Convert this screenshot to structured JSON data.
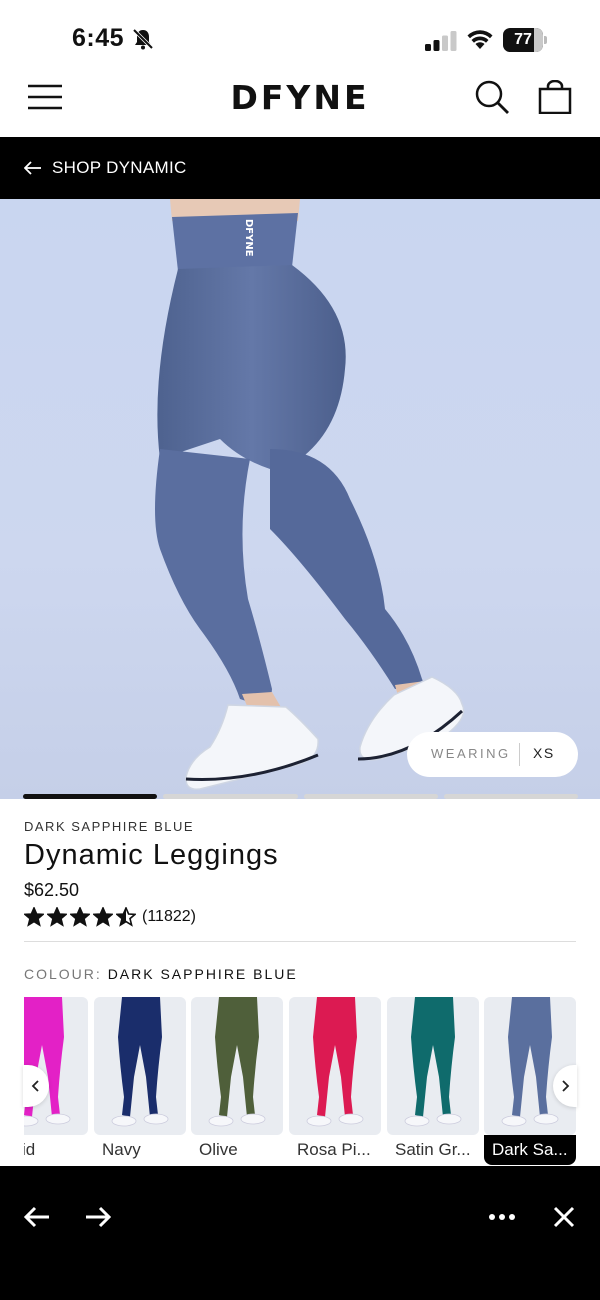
{
  "status_bar": {
    "time": "6:45",
    "battery_level": "77",
    "battery_fraction": 0.77,
    "icons": [
      "bell-slash-icon",
      "cellular-signal-icon",
      "wifi-icon",
      "battery-icon"
    ]
  },
  "header": {
    "logo_text": "DFYNE",
    "icons": [
      "hamburger-menu-icon",
      "search-icon",
      "shopping-bag-icon"
    ]
  },
  "shop_bar": {
    "label": "SHOP DYNAMIC",
    "icon": "arrow-left-icon"
  },
  "hero": {
    "waistband_text": "DFYNE",
    "wearing_label": "WEARING",
    "wearing_size": "XS",
    "slide_count": 4,
    "active_slide": 1
  },
  "product": {
    "colour_name": "DARK SAPPHIRE BLUE",
    "title": "Dynamic Leggings",
    "price": "$62.50",
    "rating": 4.5,
    "review_count": "(11822)",
    "colour_label": "COLOUR:",
    "colour_value": "DARK SAPPHIRE BLUE"
  },
  "swatches": [
    {
      "label": "chid",
      "color": "#e321c6",
      "selected": false
    },
    {
      "label": "Navy",
      "color": "#1a2d6b",
      "selected": false
    },
    {
      "label": "Olive",
      "color": "#4f5f3a",
      "selected": false
    },
    {
      "label": "Rosa Pi...",
      "color": "#dc1a52",
      "selected": false
    },
    {
      "label": "Satin Gr...",
      "color": "#0f6b6c",
      "selected": false
    },
    {
      "label": "Dark Sa...",
      "color": "#5a6f9e",
      "selected": true
    }
  ],
  "browser_bar": {
    "icons": [
      "arrow-left-icon",
      "arrow-right-icon",
      "more-dots-icon",
      "close-icon"
    ]
  },
  "colors": {
    "accent": "#000000",
    "legging_blue": "#5b6fa0",
    "hero_bg": "#c9d6f0"
  }
}
